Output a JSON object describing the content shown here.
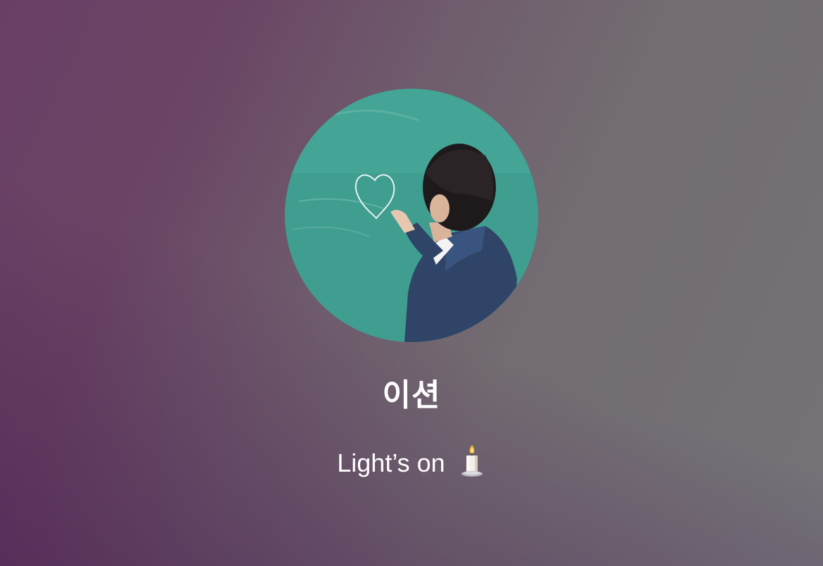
{
  "profile": {
    "name": "이션",
    "status_text": "Light’s on",
    "status_icon": "candle-icon"
  },
  "colors": {
    "background_left": "#6a3f66",
    "background_right": "#747278",
    "text": "#ffffff"
  }
}
